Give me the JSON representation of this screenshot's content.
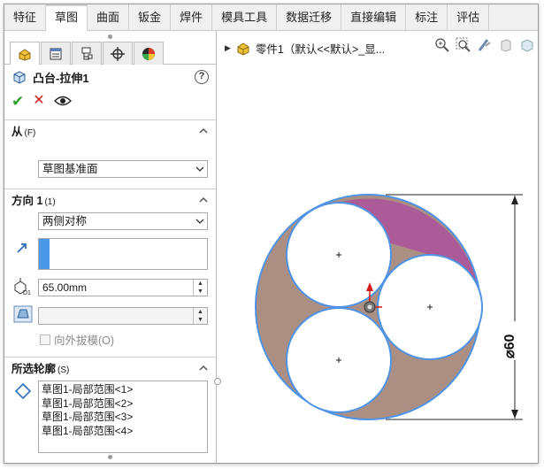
{
  "tabs": [
    "特征",
    "草图",
    "曲面",
    "钣金",
    "焊件",
    "模具工具",
    "数据迁移",
    "直接编辑",
    "标注",
    "评估"
  ],
  "active_tab": "草图",
  "property_manager": {
    "feature_title": "凸台-拉伸1",
    "help_label": "?",
    "from_group": {
      "label": "从",
      "shortcut": "(F)",
      "selected": "草图基准面"
    },
    "direction_group": {
      "label": "方向",
      "number": "1",
      "shortcut": "(1)",
      "end_condition": "两侧对称",
      "depth_value": "65.00mm",
      "draft_outward_label": "向外拔模(O)"
    },
    "contours_group": {
      "label": "所选轮廓",
      "shortcut": "(S)",
      "items": [
        "草图1-局部范围<1>",
        "草图1-局部范围<2>",
        "草图1-局部范围<3>",
        "草图1-局部范围<4>"
      ]
    }
  },
  "graphics": {
    "tree_label": "零件1（默认<<默认>_显...",
    "dimension_label": "⌀60",
    "colors": {
      "outer_region": "#ac8f83",
      "highlight_region": "#ab5b97",
      "edge": "#4f93e6",
      "accent_blue": "#4c98e8"
    }
  }
}
